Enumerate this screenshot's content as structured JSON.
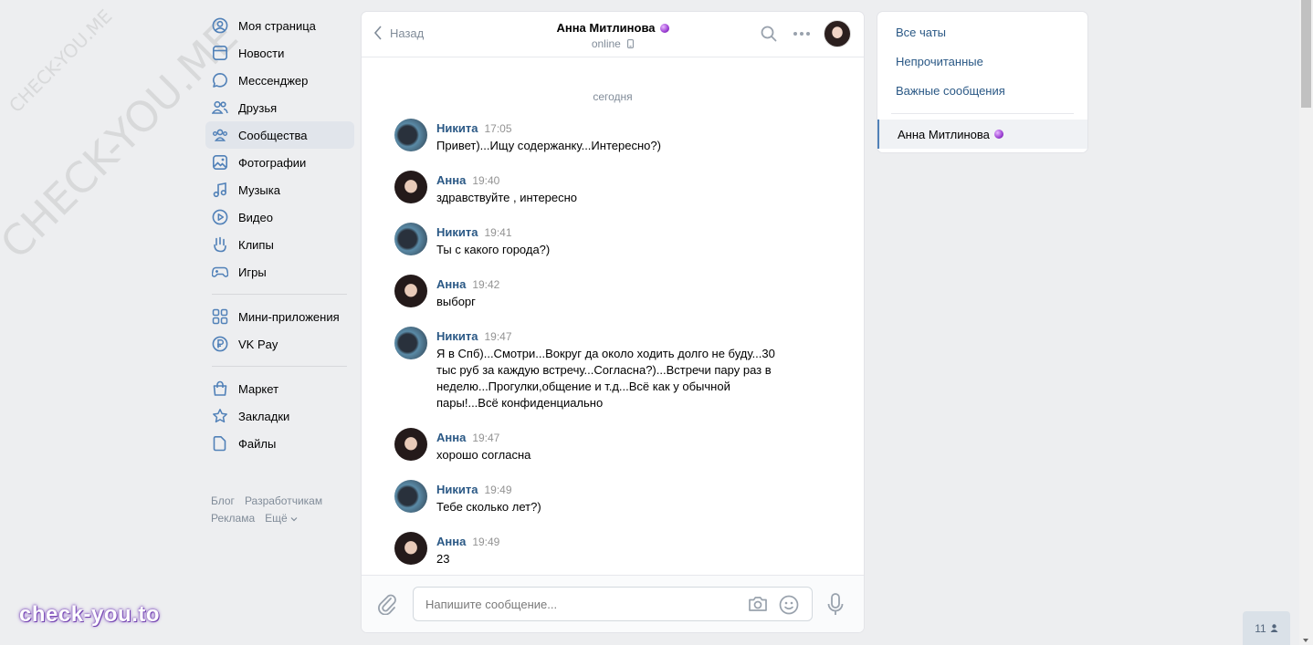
{
  "watermark": {
    "big": "CHECK-YOU.ME",
    "small": "CHECK-YOU.ME",
    "brand": "check-you.to"
  },
  "nav": {
    "main": [
      {
        "label": "Моя страница",
        "icon": "user-circle-icon"
      },
      {
        "label": "Новости",
        "icon": "news-icon"
      },
      {
        "label": "Мессенджер",
        "icon": "message-icon"
      },
      {
        "label": "Друзья",
        "icon": "friends-icon"
      },
      {
        "label": "Сообщества",
        "icon": "communities-icon",
        "active": true
      },
      {
        "label": "Фотографии",
        "icon": "photo-icon"
      },
      {
        "label": "Музыка",
        "icon": "music-icon"
      },
      {
        "label": "Видео",
        "icon": "video-icon"
      },
      {
        "label": "Клипы",
        "icon": "clips-icon"
      },
      {
        "label": "Игры",
        "icon": "gamepad-icon"
      }
    ],
    "apps": [
      {
        "label": "Мини-приложения",
        "icon": "apps-icon"
      },
      {
        "label": "VK Pay",
        "icon": "vkpay-icon"
      }
    ],
    "tools": [
      {
        "label": "Маркет",
        "icon": "market-icon"
      },
      {
        "label": "Закладки",
        "icon": "star-icon"
      },
      {
        "label": "Файлы",
        "icon": "file-icon"
      }
    ],
    "footer": {
      "blog": "Блог",
      "dev": "Разработчикам",
      "ads": "Реклама",
      "more": "Ещё"
    }
  },
  "chat": {
    "back_label": "Назад",
    "peer_name": "Анна Митлинова",
    "peer_status": "online",
    "day_label": "сегодня",
    "messages": [
      {
        "author": "Никита",
        "time": "17:05",
        "text": "Привет)...Ищу содержанку...Интересно?)",
        "who": "nikita"
      },
      {
        "author": "Анна",
        "time": "19:40",
        "text": "здравствуйте , интересно",
        "who": "anna"
      },
      {
        "author": "Никита",
        "time": "19:41",
        "text": "Ты с какого города?)",
        "who": "nikita"
      },
      {
        "author": "Анна",
        "time": "19:42",
        "text": "выборг",
        "who": "anna"
      },
      {
        "author": "Никита",
        "time": "19:47",
        "text": "Я в Спб)...Смотри...Вокруг да около ходить долго не буду...30 тыс руб за каждую встречу...Согласна?)...Встречи пару раз в неделю...Прогулки,общение и т.д...Всё как у обычной пары!...Всё конфиденциально",
        "who": "nikita"
      },
      {
        "author": "Анна",
        "time": "19:47",
        "text": "хорошо согласна",
        "who": "anna"
      },
      {
        "author": "Никита",
        "time": "19:49",
        "text": "Тебе сколько лет?)",
        "who": "nikita"
      },
      {
        "author": "Анна",
        "time": "19:49",
        "text": "23",
        "who": "anna"
      }
    ],
    "composer_placeholder": "Напишите сообщение..."
  },
  "right_panel": {
    "all_chats": "Все чаты",
    "unread": "Непрочитанные",
    "important": "Важные сообщения",
    "active_chat": "Анна Митлинова"
  },
  "online_counter": "11",
  "colors": {
    "link": "#2a5885",
    "accent": "#5181b8",
    "background": "#edeef0"
  }
}
